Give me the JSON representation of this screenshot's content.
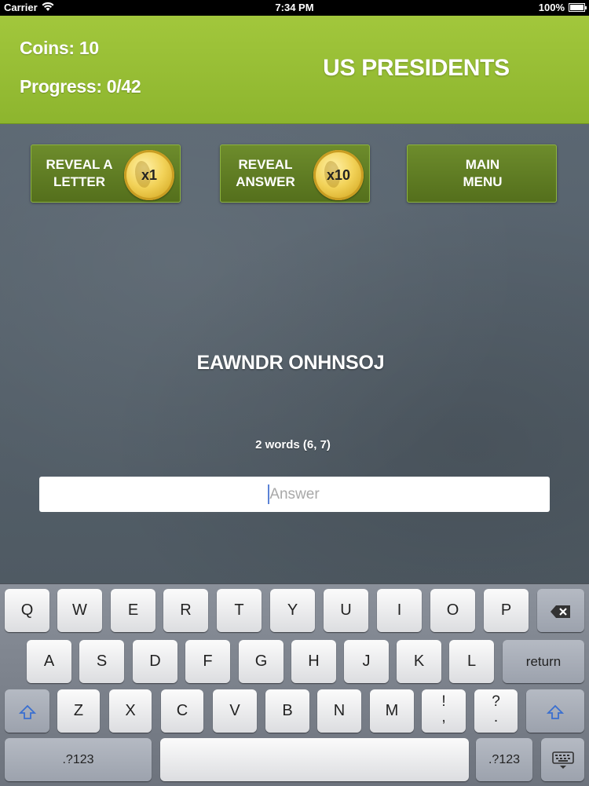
{
  "status_bar": {
    "carrier": "Carrier",
    "time": "7:34 PM",
    "battery": "100%"
  },
  "header": {
    "coins": "Coins: 10",
    "progress": "Progress: 0/42",
    "title": "US PRESIDENTS"
  },
  "buttons": {
    "reveal_letter": {
      "label_line1": "REVEAL A",
      "label_line2": "LETTER",
      "cost": "x1"
    },
    "reveal_answer": {
      "label_line1": "REVEAL",
      "label_line2": "ANSWER",
      "cost": "x10"
    },
    "main_menu": {
      "label_line1": "MAIN",
      "label_line2": "MENU"
    }
  },
  "puzzle": {
    "scrambled": "EAWNDR ONHNSOJ",
    "hint": "2 words (6, 7)"
  },
  "answer_input": {
    "placeholder": "Answer",
    "value": ""
  },
  "keyboard": {
    "row1": [
      "Q",
      "W",
      "E",
      "R",
      "T",
      "Y",
      "U",
      "I",
      "O",
      "P"
    ],
    "row2": [
      "A",
      "S",
      "D",
      "F",
      "G",
      "H",
      "J",
      "K",
      "L"
    ],
    "row3": [
      "Z",
      "X",
      "C",
      "V",
      "B",
      "N",
      "M"
    ],
    "return": "return",
    "numbers": ".?123",
    "exclaim_top": "!",
    "exclaim_bottom": ",",
    "question_top": "?",
    "question_bottom": ".",
    "icons": [
      "backspace-icon",
      "shift-icon",
      "keyboard-hide-icon"
    ]
  }
}
